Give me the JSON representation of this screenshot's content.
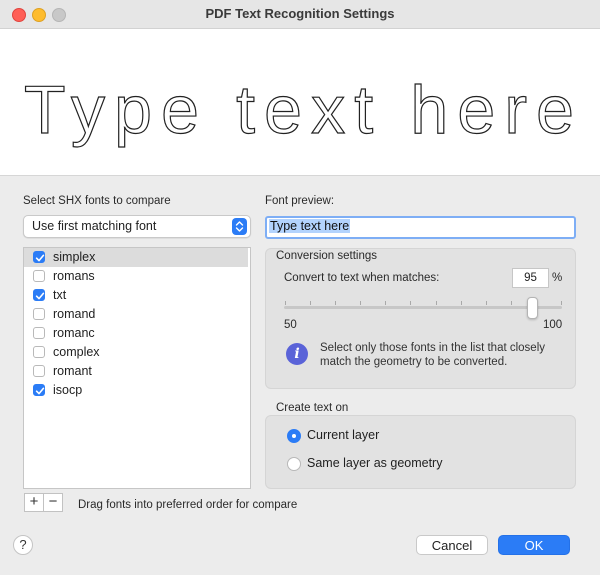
{
  "window": {
    "title": "PDF Text Recognition Settings"
  },
  "preview_banner": {
    "text": "Type text here"
  },
  "left_panel": {
    "heading": "Select SHX fonts to compare",
    "match_mode": {
      "selected": "Use first matching font"
    },
    "fonts": [
      {
        "name": "simplex",
        "checked": true,
        "selected": true
      },
      {
        "name": "romans",
        "checked": false,
        "selected": false
      },
      {
        "name": "txt",
        "checked": true,
        "selected": false
      },
      {
        "name": "romand",
        "checked": false,
        "selected": false
      },
      {
        "name": "romanc",
        "checked": false,
        "selected": false
      },
      {
        "name": "complex",
        "checked": false,
        "selected": false
      },
      {
        "name": "romant",
        "checked": false,
        "selected": false
      },
      {
        "name": "isocp",
        "checked": true,
        "selected": false
      }
    ],
    "add_label": "+",
    "remove_label": "−",
    "drag_hint": "Drag fonts into preferred order for compare"
  },
  "right_panel": {
    "font_preview_label": "Font preview:",
    "font_preview_value": "Type text here",
    "conversion": {
      "heading": "Conversion settings",
      "threshold_label": "Convert to text when matches:",
      "threshold_value": "95",
      "threshold_unit": "%",
      "slider_min_label": "50",
      "slider_max_label": "100",
      "slider_value": 95,
      "info_icon_glyph": "i",
      "info_text": "Select only those fonts in the list that closely match the geometry to be converted."
    },
    "create_text_on": {
      "heading": "Create text on",
      "options": [
        {
          "label": "Current layer",
          "selected": true
        },
        {
          "label": "Same layer as geometry",
          "selected": false
        }
      ]
    }
  },
  "footer": {
    "help_label": "?",
    "cancel_label": "Cancel",
    "ok_label": "OK"
  },
  "colors": {
    "accent": "#2b7cf6",
    "info_icon": "#5a63d8"
  },
  "icons": [
    "window-close-icon",
    "window-minimize-icon",
    "window-zoom-icon",
    "dropdown-chevron-icon",
    "checkmark-icon",
    "info-icon",
    "help-icon"
  ]
}
